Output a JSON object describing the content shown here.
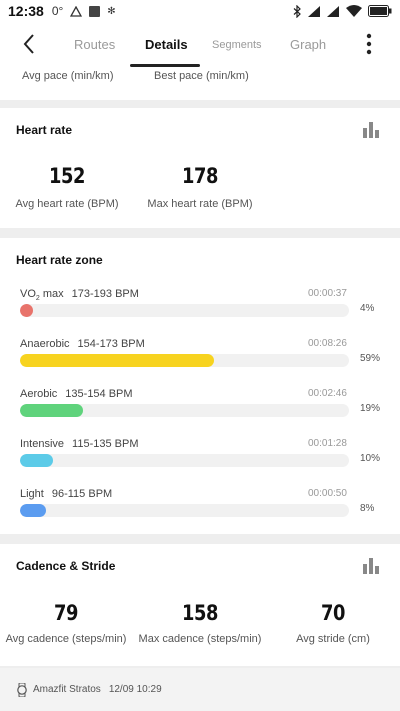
{
  "status_bar": {
    "time": "12:38",
    "temp": "0°"
  },
  "nav": {
    "tabs": [
      {
        "label": "Routes"
      },
      {
        "label": "Details"
      },
      {
        "label": "Segments"
      },
      {
        "label": "Graph"
      }
    ],
    "active_tab": "Details"
  },
  "pace": {
    "avg_label": "Avg pace (min/km)",
    "best_label": "Best pace (min/km)"
  },
  "heart_rate": {
    "title": "Heart rate",
    "avg_value": "152",
    "avg_label": "Avg heart rate (BPM)",
    "max_value": "178",
    "max_label": "Max heart rate (BPM)"
  },
  "hr_zone": {
    "title": "Heart rate zone",
    "zones": [
      {
        "name": "VO",
        "sub": "2",
        "name_suffix": " max",
        "range": "173-193 BPM",
        "time": "00:00:37",
        "pct": "4%",
        "fraction": 0.04,
        "color": "#e8736b"
      },
      {
        "name": "Anaerobic",
        "sub": "",
        "name_suffix": "",
        "range": "154-173 BPM",
        "time": "00:08:26",
        "pct": "59%",
        "fraction": 0.59,
        "color": "#f7d31f"
      },
      {
        "name": "Aerobic",
        "sub": "",
        "name_suffix": "",
        "range": "135-154 BPM",
        "time": "00:02:46",
        "pct": "19%",
        "fraction": 0.19,
        "color": "#5fd37c"
      },
      {
        "name": "Intensive",
        "sub": "",
        "name_suffix": "",
        "range": "115-135 BPM",
        "time": "00:01:28",
        "pct": "10%",
        "fraction": 0.1,
        "color": "#5ccbe8"
      },
      {
        "name": "Light",
        "sub": "",
        "name_suffix": "",
        "range": "96-115 BPM",
        "time": "00:00:50",
        "pct": "8%",
        "fraction": 0.08,
        "color": "#5b9cf0"
      }
    ]
  },
  "cadence": {
    "title": "Cadence & Stride",
    "avg_cadence_value": "79",
    "avg_cadence_label": "Avg cadence (steps/min)",
    "max_cadence_value": "158",
    "max_cadence_label": "Max cadence (steps/min)",
    "avg_stride_value": "70",
    "avg_stride_label": "Avg stride (cm)"
  },
  "footer": {
    "device": "Amazfit Stratos",
    "datetime": "12/09 10:29"
  },
  "colors": {
    "accent_dark": "#111111",
    "muted": "#9a9a9a",
    "background": "#eeeeee"
  }
}
